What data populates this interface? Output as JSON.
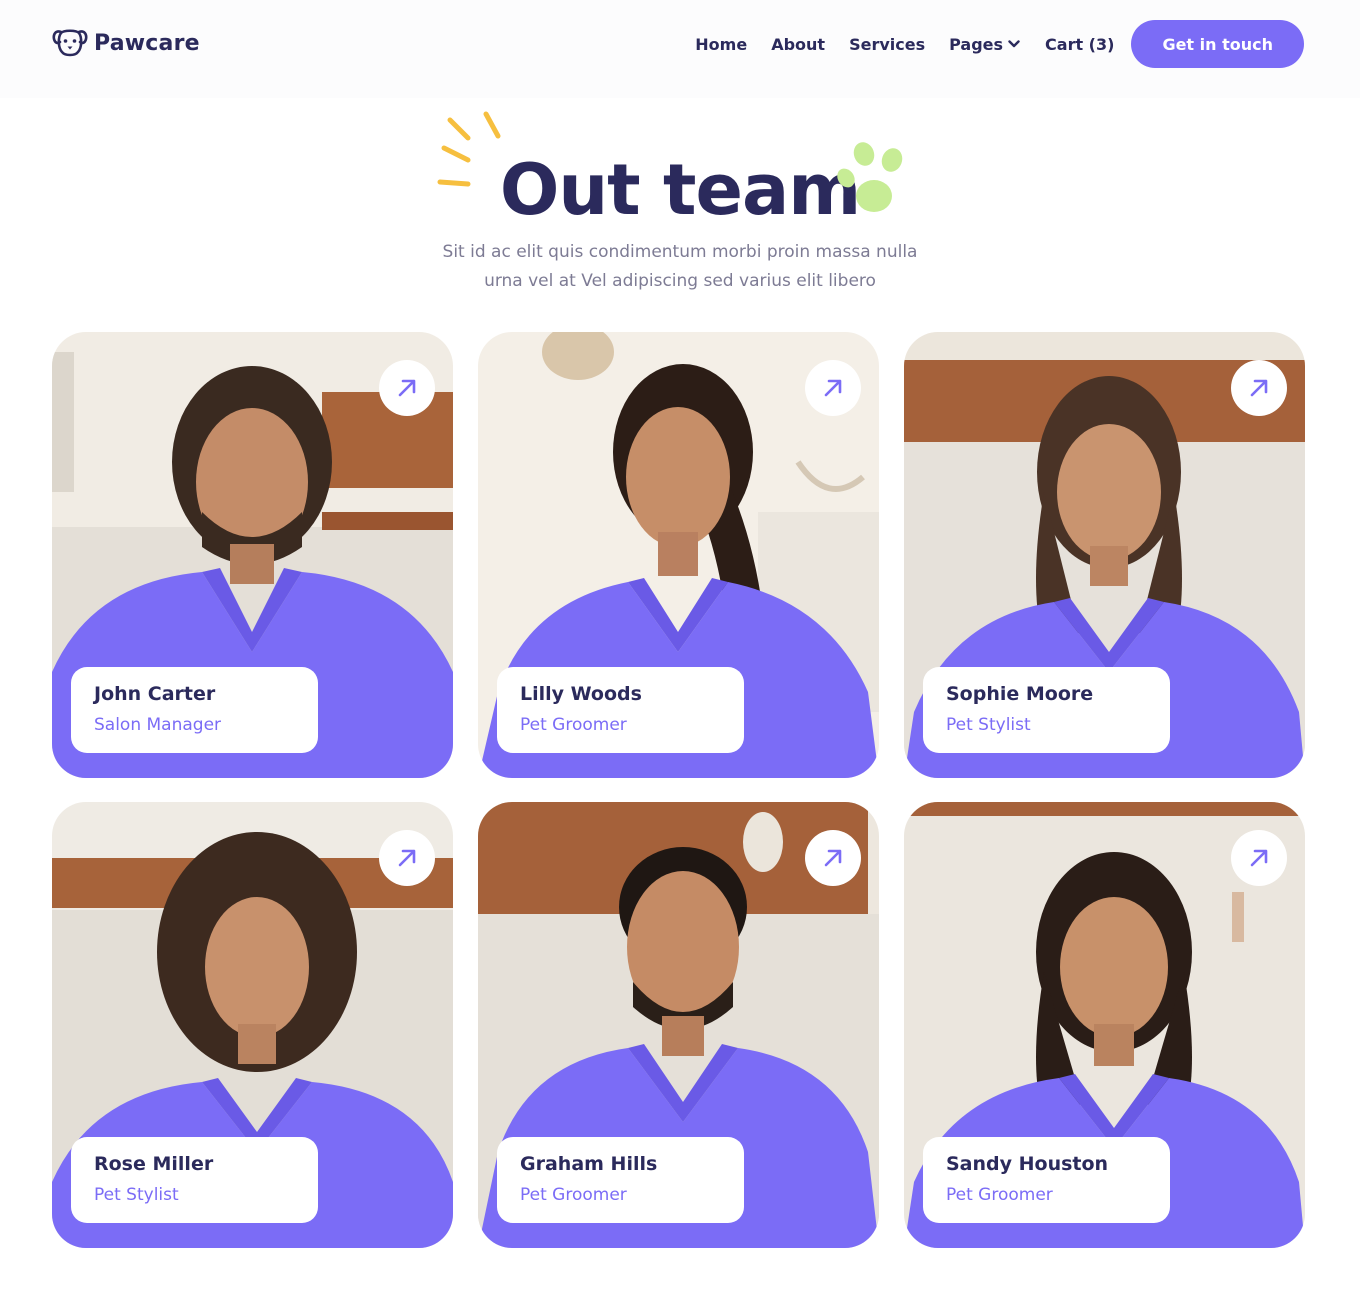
{
  "brand": {
    "name": "Pawcare",
    "accent": "#7b6cf6",
    "dark": "#2b2a5c"
  },
  "nav": {
    "home": "Home",
    "about": "About",
    "services": "Services",
    "pages": "Pages",
    "cart": "Cart (3)",
    "cta": "Get in touch"
  },
  "hero": {
    "title": "Out team",
    "subtitle_line1": "Sit id ac elit quis condimentum morbi proin massa nulla",
    "subtitle_line2": "urna vel at Vel adipiscing sed varius elit libero"
  },
  "team": [
    {
      "name": "John Carter",
      "role": "Salon Manager"
    },
    {
      "name": "Lilly Woods",
      "role": "Pet Groomer"
    },
    {
      "name": "Sophie Moore",
      "role": "Pet Stylist"
    },
    {
      "name": "Rose Miller",
      "role": "Pet Stylist"
    },
    {
      "name": "Graham Hills",
      "role": "Pet Groomer"
    },
    {
      "name": "Sandy Houston",
      "role": "Pet Groomer"
    }
  ],
  "icons": {
    "logo": "dog-face-icon",
    "pages_dropdown": "chevron-down-icon",
    "card_link": "arrow-up-right-icon",
    "title_spark": "sparkle-lines-icon",
    "title_paw": "paw-print-icon"
  }
}
